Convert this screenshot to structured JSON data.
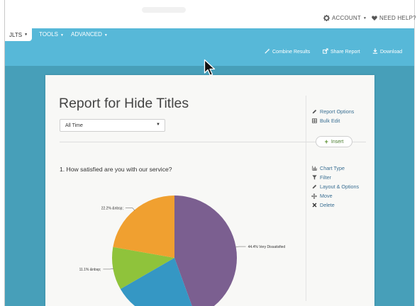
{
  "topbar": {
    "account_label": "ACCOUNT",
    "help_label": "NEED HELP?",
    "account_icon": "gear-icon",
    "help_icon": "heart-icon"
  },
  "navbar": {
    "active_tab": "JLTS",
    "tabs": [
      "TOOLS",
      "ADVANCED"
    ],
    "actions": [
      {
        "label": "Combine Results",
        "icon": "wand-icon"
      },
      {
        "label": "Share Report",
        "icon": "share-icon"
      },
      {
        "label": "Download",
        "icon": "download-icon"
      }
    ],
    "color": "#57b8d8"
  },
  "report": {
    "title": "Report for Hide Titles",
    "date_filter": "All Time",
    "options": [
      {
        "label": "Report Options",
        "icon": "pencil-icon"
      },
      {
        "label": "Bulk Edit",
        "icon": "table-icon"
      }
    ],
    "insert_label": "Insert"
  },
  "question": {
    "text": "1. How satisfied are you with our service?",
    "actions": [
      {
        "label": "Chart Type",
        "icon": "chart-icon"
      },
      {
        "label": "Filter",
        "icon": "filter-icon"
      },
      {
        "label": "Layout & Options",
        "icon": "pencil-icon"
      },
      {
        "label": "Move",
        "icon": "move-icon"
      },
      {
        "label": "Delete",
        "icon": "delete-icon"
      }
    ]
  },
  "chart_data": {
    "type": "pie",
    "slices": [
      {
        "label": "44.4% Very Dissatisfied",
        "value": 44.4,
        "color": "#7b5f90"
      },
      {
        "label": "",
        "value": 22.2,
        "color": "#3597c4"
      },
      {
        "label": "11.1% &nbsp;",
        "value": 11.1,
        "color": "#8fc33b"
      },
      {
        "label": "22.2% &nbsp;",
        "value": 22.2,
        "color": "#f0a030"
      }
    ]
  }
}
